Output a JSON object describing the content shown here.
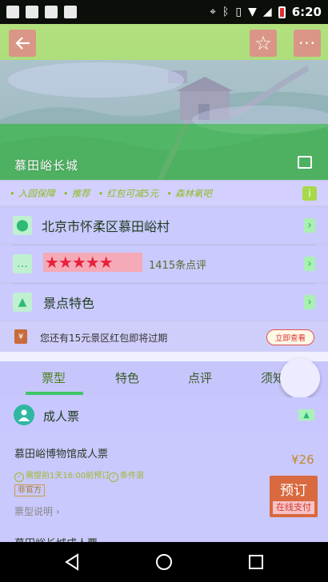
{
  "status_bar": {
    "time": "6:20"
  },
  "hero": {
    "title": "慕田峪长城"
  },
  "tags": [
    "入园保障",
    "推荐",
    "红包可减5元",
    "森林氧吧"
  ],
  "info_icon": "i",
  "address_row": {
    "text": "北京市怀柔区慕田峪村"
  },
  "rating_row": {
    "stars": "★★★★★",
    "reviews": "1415条点评"
  },
  "features_row": {
    "text": "景点特色"
  },
  "coupon": {
    "text": "您还有15元景区红包即将过期",
    "button": "立即查看"
  },
  "tabs": [
    {
      "label": "票型"
    },
    {
      "label": "特色"
    },
    {
      "label": "点评"
    },
    {
      "label": "须知"
    }
  ],
  "ticket_group": {
    "title": "成人票"
  },
  "ticket": {
    "name": "慕田峪博物馆成人票",
    "note1": "需提前1天16:00前预订",
    "note2": "条件退",
    "badge": "非官方",
    "explain": "票型说明 ›",
    "price": "¥26",
    "book_label": "预订",
    "pay_label": "在线支付"
  },
  "next_ticket": {
    "name": "慕田峪长城成人票"
  },
  "colors": {
    "accent": "#2dbb75",
    "price": "#c3892f",
    "book": "#d9693e"
  }
}
